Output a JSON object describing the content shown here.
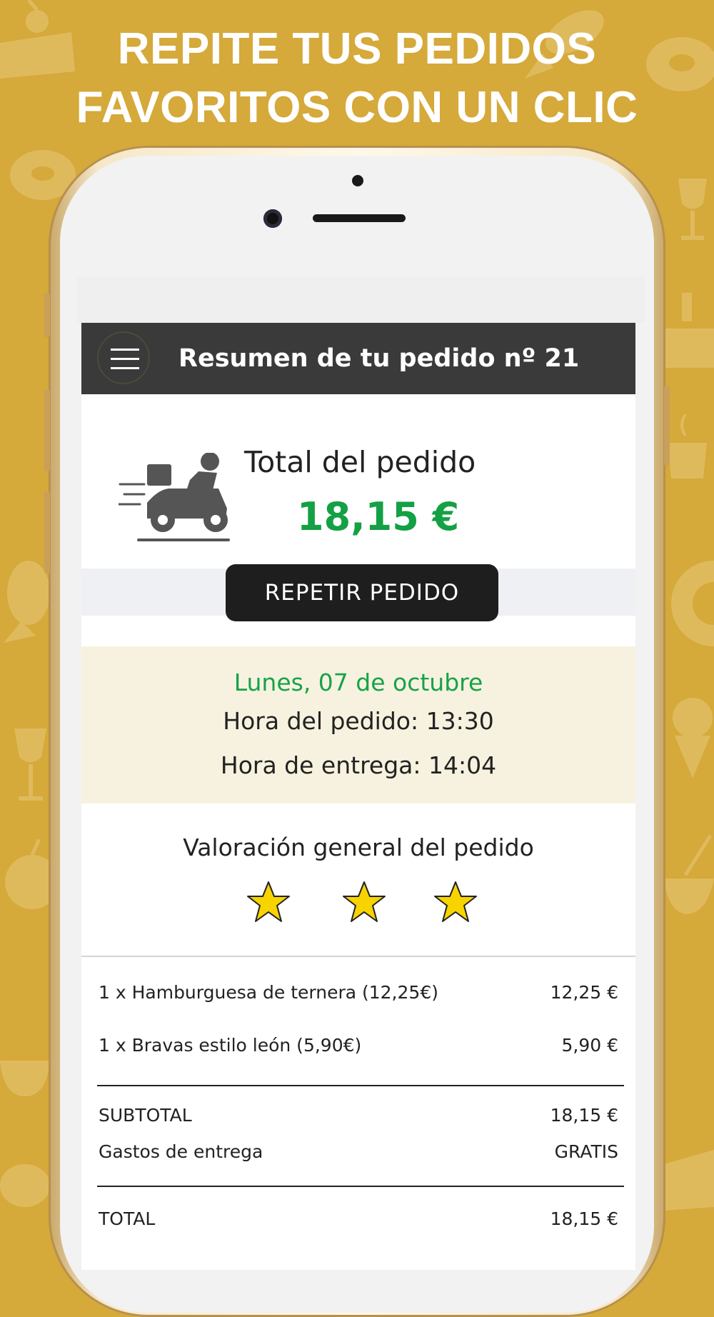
{
  "headline": {
    "line1": "REPITE TUS PEDIDOS",
    "line2": "FAVORITOS CON UN CLIC"
  },
  "colors": {
    "background": "#d5a93a",
    "accent_green": "#14a044",
    "appbar": "#3a3a3a",
    "star": "#f7d400"
  },
  "appbar": {
    "menu_icon": "hamburger-menu-icon",
    "title": "Resumen de tu pedido nº 21"
  },
  "summary": {
    "icon": "delivery-scooter-icon",
    "total_label": "Total del pedido",
    "total_value": "18,15 €",
    "repeat_button": "REPETIR PEDIDO"
  },
  "schedule": {
    "date": "Lunes, 07 de octubre",
    "order_time": "Hora del pedido: 13:30",
    "delivery_time": "Hora de entrega: 14:04"
  },
  "rating": {
    "title": "Valoración general del pedido",
    "stars": 3
  },
  "items": [
    {
      "description": "1 x  Hamburguesa de ternera (12,25€)",
      "price": "12,25 €"
    },
    {
      "description": "1 x  Bravas estilo león (5,90€)",
      "price": "5,90 €"
    }
  ],
  "totals": {
    "subtotal_label": "SUBTOTAL",
    "subtotal_value": "18,15 €",
    "delivery_label": "Gastos de entrega",
    "delivery_value": "GRATIS",
    "total_label": "TOTAL",
    "total_value": "18,15 €"
  }
}
